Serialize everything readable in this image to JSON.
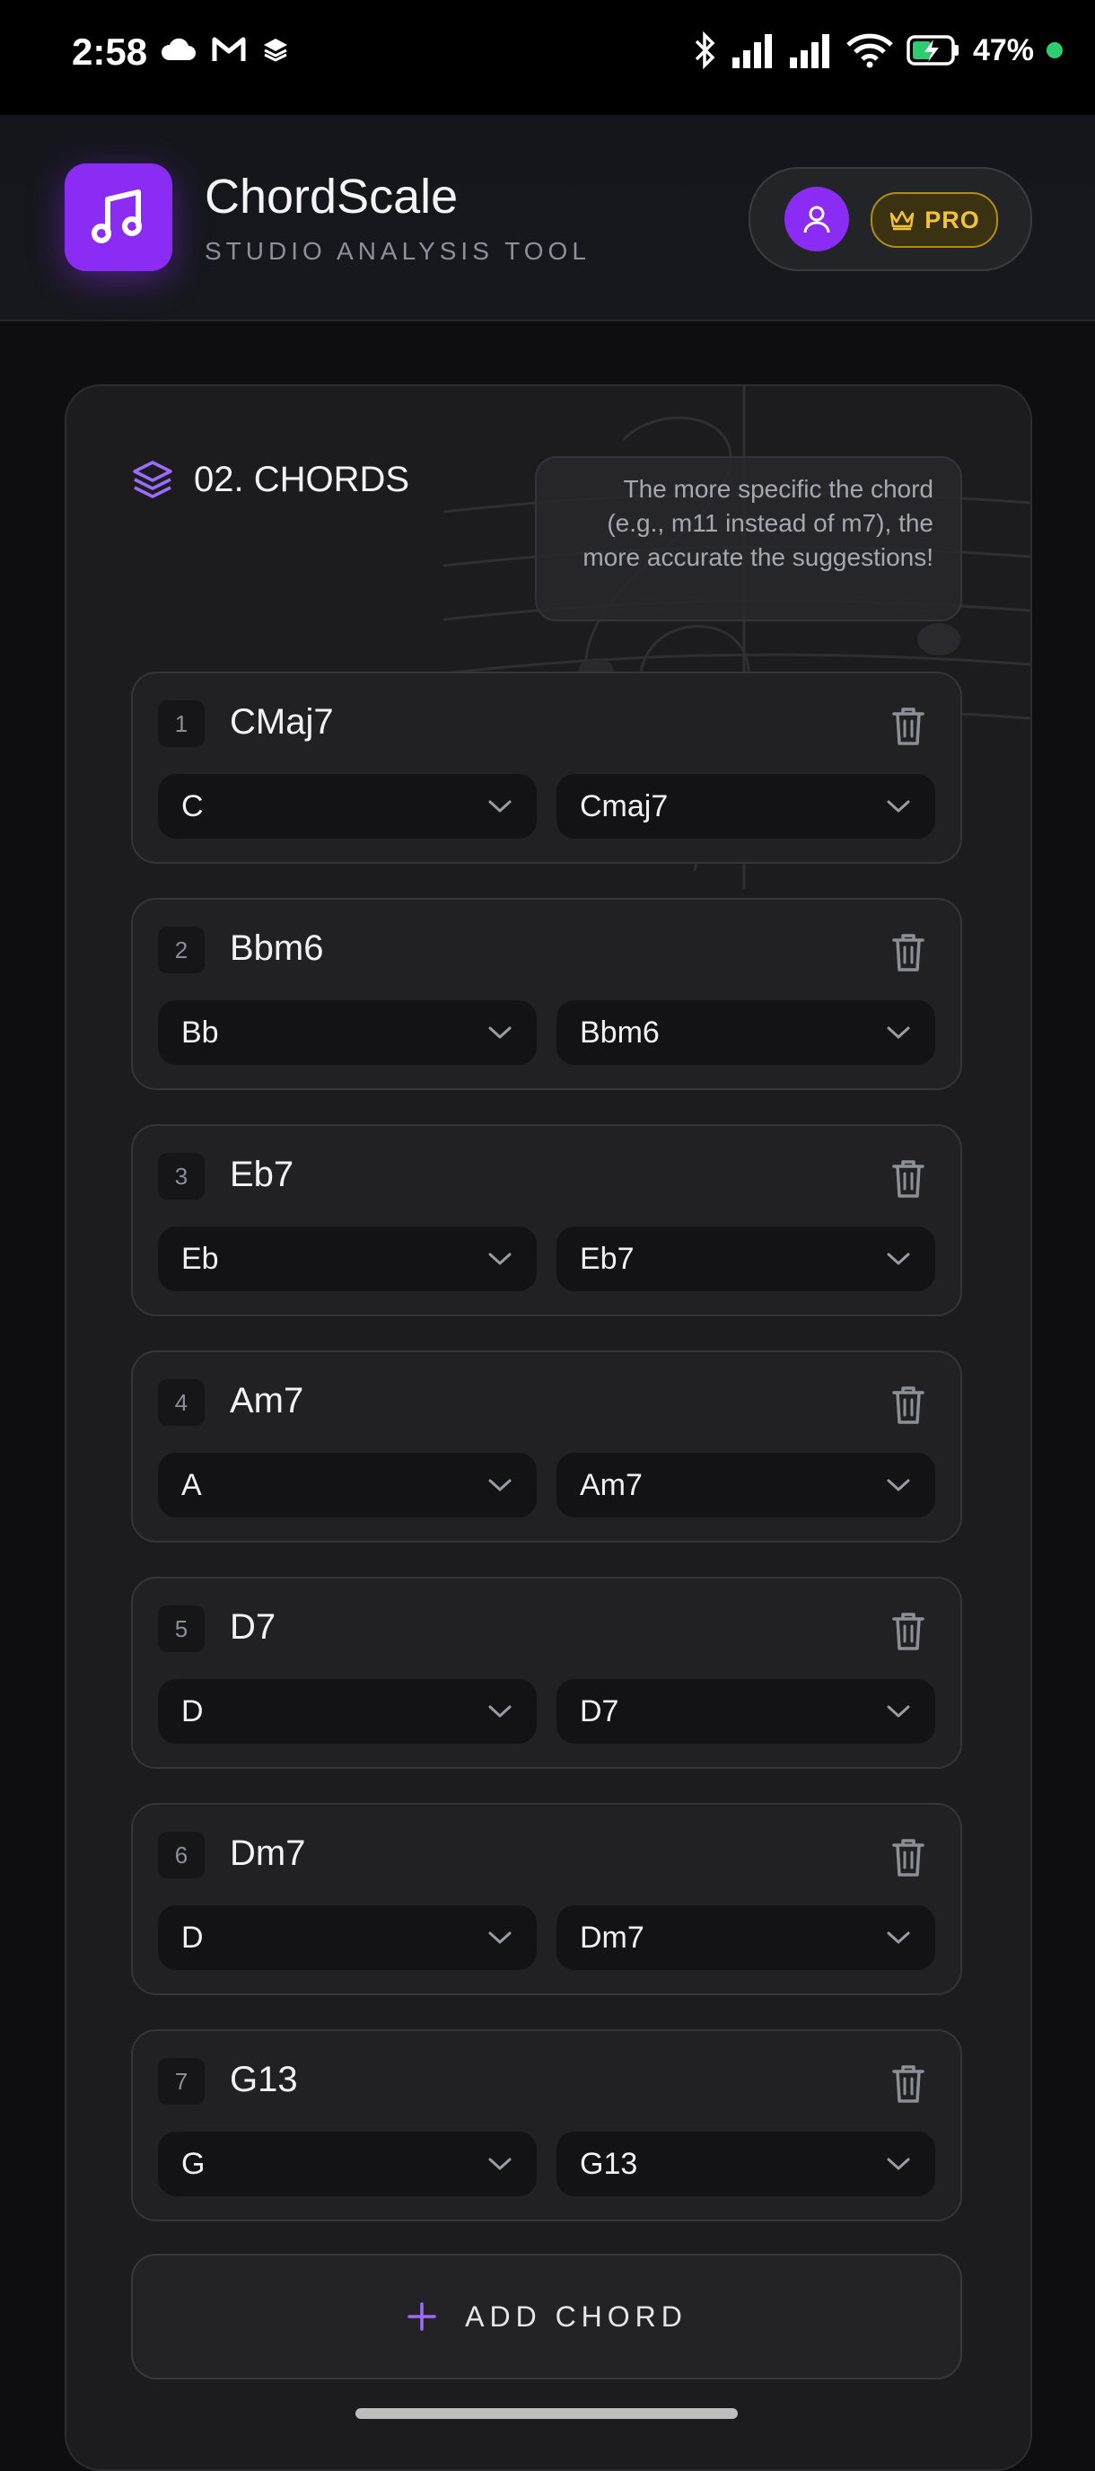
{
  "status_bar": {
    "time": "2:58",
    "battery": "47%"
  },
  "header": {
    "title": "ChordScale",
    "subtitle": "STUDIO ANALYSIS TOOL",
    "pro_label": "PRO"
  },
  "section": {
    "title": "02. CHORDS",
    "hint": "The more specific the chord (e.g., m11 instead of m7), the more accurate the suggestions!"
  },
  "chords": [
    {
      "num": "1",
      "name": "CMaj7",
      "root": "C",
      "chord": "Cmaj7"
    },
    {
      "num": "2",
      "name": "Bbm6",
      "root": "Bb",
      "chord": "Bbm6"
    },
    {
      "num": "3",
      "name": "Eb7",
      "root": "Eb",
      "chord": "Eb7"
    },
    {
      "num": "4",
      "name": "Am7",
      "root": "A",
      "chord": "Am7"
    },
    {
      "num": "5",
      "name": "D7",
      "root": "D",
      "chord": "D7"
    },
    {
      "num": "6",
      "name": "Dm7",
      "root": "D",
      "chord": "Dm7"
    },
    {
      "num": "7",
      "name": "G13",
      "root": "G",
      "chord": "G13"
    }
  ],
  "add_button": {
    "label": "ADD CHORD"
  },
  "colors": {
    "accent": "#8b2cf5",
    "pro_gold": "#f2c23a",
    "background": "#0e0e10",
    "card": "#1c1c1f"
  }
}
